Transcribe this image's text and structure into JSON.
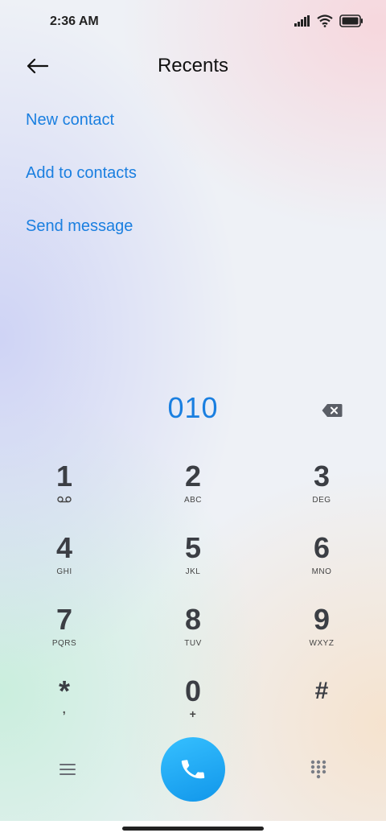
{
  "status_bar": {
    "time": "2:36 AM"
  },
  "header": {
    "title": "Recents"
  },
  "actions": [
    {
      "label": "New contact"
    },
    {
      "label": "Add to contacts"
    },
    {
      "label": "Send message"
    }
  ],
  "dialer": {
    "number": "010"
  },
  "keypad": [
    {
      "digit": "1",
      "letters": ""
    },
    {
      "digit": "2",
      "letters": "ABC"
    },
    {
      "digit": "3",
      "letters": "DEG"
    },
    {
      "digit": "4",
      "letters": "GHI"
    },
    {
      "digit": "5",
      "letters": "JKL"
    },
    {
      "digit": "6",
      "letters": "MNO"
    },
    {
      "digit": "7",
      "letters": "PQRS"
    },
    {
      "digit": "8",
      "letters": "TUV"
    },
    {
      "digit": "9",
      "letters": "WXYZ"
    },
    {
      "digit": "*",
      "letters": ","
    },
    {
      "digit": "0",
      "letters": "+"
    },
    {
      "digit": "#",
      "letters": ""
    }
  ],
  "icons": {
    "back": "back-arrow-icon",
    "backspace": "backspace-icon",
    "voicemail": "voicemail-icon",
    "menu": "menu-icon",
    "call": "phone-icon",
    "dialpad": "dialpad-icon",
    "signal": "signal-icon",
    "wifi": "wifi-icon",
    "battery": "battery-icon"
  },
  "colors": {
    "accent": "#1a7fe0",
    "call_button": "#1ea8f5",
    "key_text": "#3b3e44"
  }
}
